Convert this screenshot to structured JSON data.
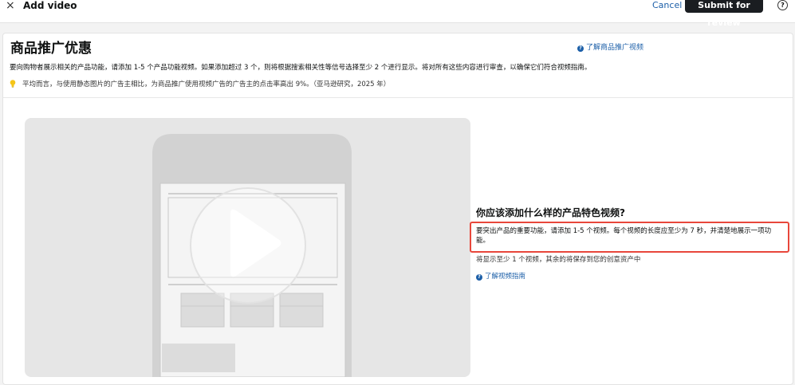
{
  "topbar": {
    "close_glyph": "×",
    "title": "Add video",
    "cancel_label": "Cancel",
    "submit_label": "Submit for review",
    "help_glyph": "?"
  },
  "card": {
    "title": "商品推广优惠",
    "learn_promo_link": "了解商品推广视频",
    "description": "要向购物者展示相关的产品功能，请添加 1-5 个产品功能视频。如果添加超过 3 个，则将根据搜索相关性等信号选择至少 2 个进行显示。将对所有这些内容进行审查，以确保它们符合视频指南。",
    "tip": "平均而言，与使用静态图片的广告主相比，为商品推广使用视频广告的广告主的点击率高出 9%。（亚马逊研究，2025 年）"
  },
  "side": {
    "heading": "你应该添加什么样的产品特色视频?",
    "highlight_text": "要突出产品的重要功能，请添加 1-5 个视频。每个视频的长度应至少为 7 秒，并清楚地展示一项功能。",
    "note": "将显示至少 1 个视频，其余的将保存到您的创意资产中",
    "guide_link": "了解视频指南"
  },
  "icons": {
    "close": "close-icon",
    "help": "help-circle-icon",
    "info": "info-circle-icon",
    "bulb": "lightbulb-icon",
    "play": "play-icon"
  },
  "colors": {
    "link": "#1c5fa8",
    "primary_button": "#1a1d21",
    "highlight_border": "#e8473b",
    "bulb": "#f5c518"
  }
}
